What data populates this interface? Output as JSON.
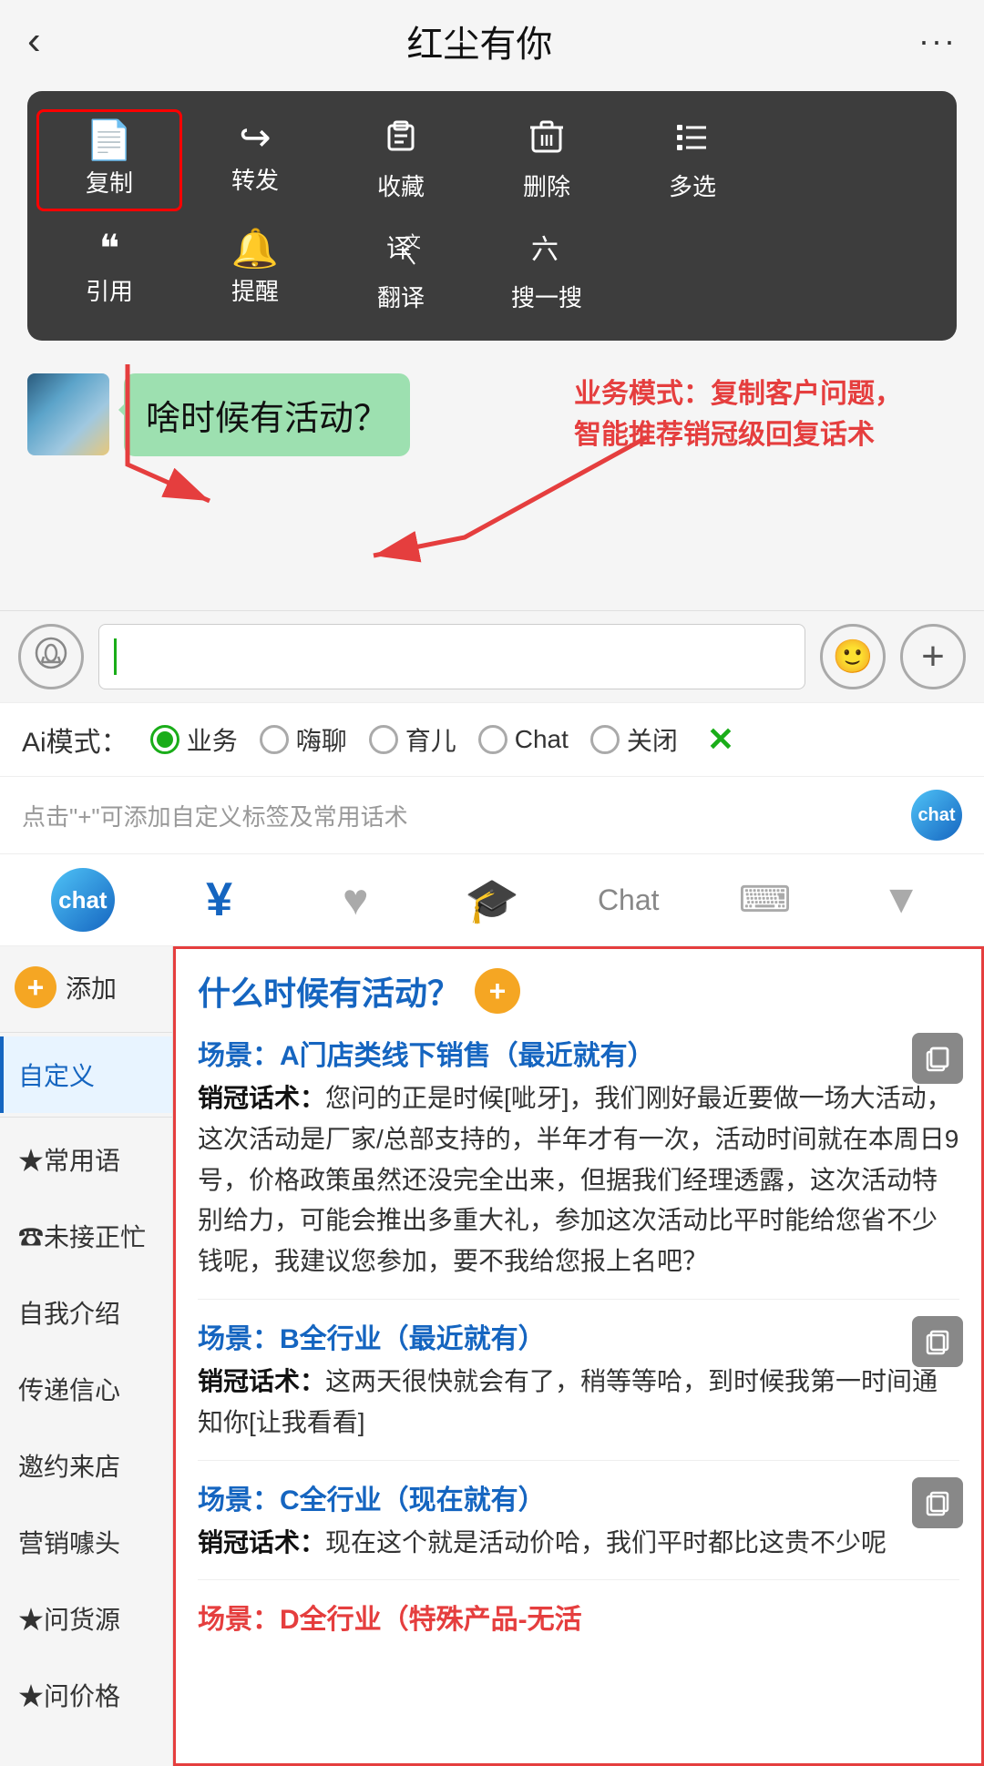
{
  "header": {
    "back_icon": "‹",
    "title": "红尘有你",
    "more_icon": "···"
  },
  "context_menu": {
    "row1": [
      {
        "icon": "📄",
        "label": "复制",
        "highlighted": true
      },
      {
        "icon": "↪",
        "label": "转发",
        "highlighted": false
      },
      {
        "icon": "🎁",
        "label": "收藏",
        "highlighted": false
      },
      {
        "icon": "🗑",
        "label": "删除",
        "highlighted": false
      },
      {
        "icon": "☰",
        "label": "多选",
        "highlighted": false
      }
    ],
    "row2": [
      {
        "icon": "❝",
        "label": "引用",
        "highlighted": false
      },
      {
        "icon": "🔔",
        "label": "提醒",
        "highlighted": false
      },
      {
        "icon": "译",
        "label": "翻译",
        "highlighted": false
      },
      {
        "icon": "六",
        "label": "搜一搜",
        "highlighted": false
      }
    ]
  },
  "chat": {
    "bubble_text": "啥时候有活动？"
  },
  "annotation": {
    "text": "业务模式：复制客户问题，\n智能推荐销冠级回复话术"
  },
  "input_area": {
    "placeholder": ""
  },
  "ai_modes": {
    "label": "Ai模式：",
    "options": [
      "业务",
      "嗨聊",
      "育儿",
      "Chat",
      "关闭"
    ],
    "active": "业务"
  },
  "hint_bar": {
    "text": "点击\"+\"可添加自定义标签及常用话术"
  },
  "toolbar": {
    "items": [
      "robot",
      "yen",
      "heart",
      "graduation",
      "chat",
      "keyboard",
      "arrow"
    ]
  },
  "sidebar": {
    "add_label": "添加",
    "items": [
      {
        "label": "自定义",
        "active": true
      },
      {
        "label": "★常用语",
        "active": false
      },
      {
        "label": "☎未接正忙",
        "active": false
      },
      {
        "label": "自我介绍",
        "active": false
      },
      {
        "label": "传递信心",
        "active": false
      },
      {
        "label": "邀约来店",
        "active": false
      },
      {
        "label": "营销噱头",
        "active": false
      },
      {
        "label": "★问货源",
        "active": false
      },
      {
        "label": "★问价格",
        "active": false
      }
    ]
  },
  "right_panel": {
    "question": "什么时候有活动？",
    "scenes": [
      {
        "label": "场景：A门店类线下销售（最近就有）",
        "content": "销冠话术：您问的正是时候[呲牙]，我们刚好最近要做一场大活动，这次活动是厂家/总部支持的，半年才有一次，活动时间就在本周日9号，价格政策虽然还没完全出来，但据我们经理透露，这次活动特别给力，可能会推出多重大礼，参加这次活动比平时能给您省不少钱呢，我建议您参加，要不我给您报上名吧？"
      },
      {
        "label": "场景：B全行业（最近就有）",
        "content": "销冠话术：这两天很快就会有了，稍等等哈，到时候我第一时间通知你[让我看看]"
      },
      {
        "label": "场景：C全行业（现在就有）",
        "content": "销冠话术：现在这个就是活动价哈，我们平时都比这贵不少呢"
      },
      {
        "label": "场景：D全行业（特殊产品-无活",
        "content": ""
      }
    ]
  }
}
